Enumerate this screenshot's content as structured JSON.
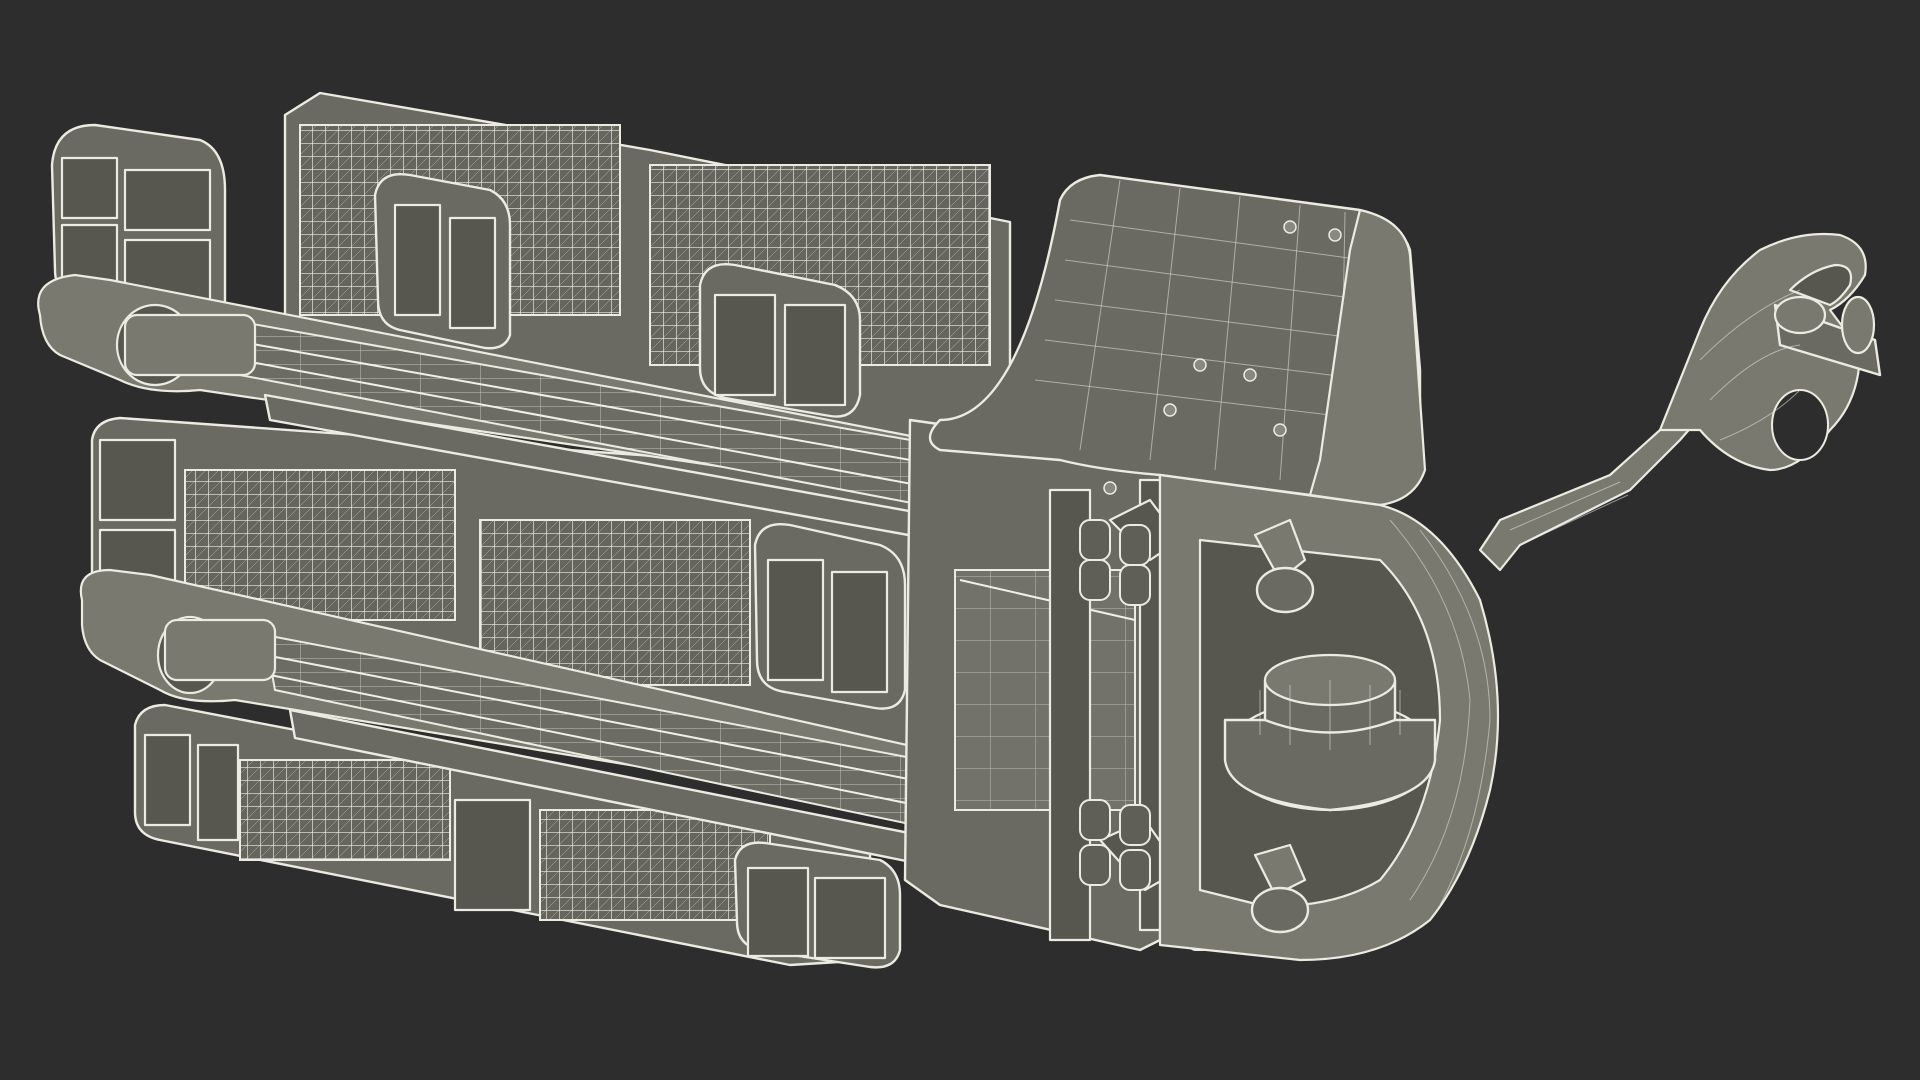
{
  "scene": {
    "background_color": "#2d2d2d",
    "model_fill": "#6b6a62",
    "wire_color": "#ecebe2",
    "render_style": "wireframe-over-shaded"
  }
}
